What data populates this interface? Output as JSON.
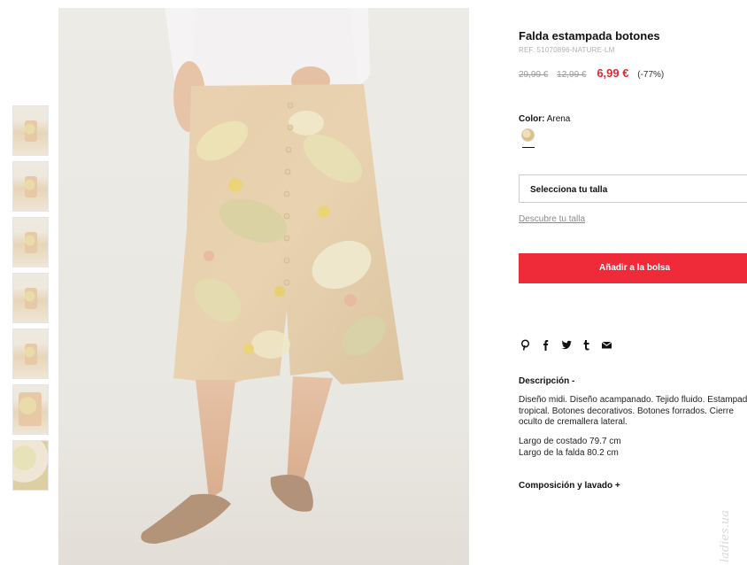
{
  "product": {
    "title": "Falda estampada botones",
    "ref": "REF. 51070896-NATURE-LM",
    "price_original": "29,99 €",
    "price_previous": "12,99 €",
    "price_current": "6,99 €",
    "discount": "(-77%)",
    "color_label": "Color:",
    "color_value": "Arena",
    "size_select_placeholder": "Selecciona tu talla",
    "size_guide_link": "Descubre tu talla",
    "add_to_bag": "Añadir a la bolsa",
    "description_title": "Descripción -",
    "description_lines": [
      "Diseño midi. Diseño acampanado. Tejido fluido. Estampado",
      "tropical. Botones decorativos. Botones forrados. Cierre",
      "oculto de cremallera lateral."
    ],
    "measure_side": "Largo de costado 79.7 cm",
    "measure_skirt": "Largo de la falda 80.2 cm",
    "composition_title": "Composición y lavado +"
  },
  "gallery": {
    "thumbnail_count": 7
  },
  "social_icons": [
    "pinterest-icon",
    "facebook-icon",
    "twitter-icon",
    "tumblr-icon",
    "mail-icon"
  ],
  "watermark": "ladies.ua",
  "colors": {
    "sale_red": "#e5252e",
    "button_red": "#ef2b3a",
    "muted_gray": "#9b9b9b"
  }
}
